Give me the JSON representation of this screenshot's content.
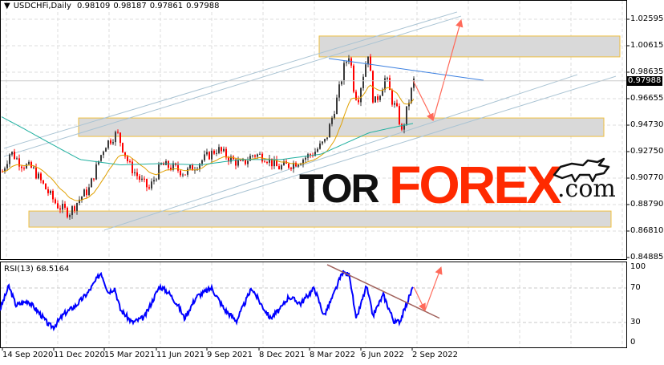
{
  "header": {
    "menu_icon": "triangle-down-icon",
    "symbol": "USDCHFi,Daily",
    "open": "0.98109",
    "high": "0.98187",
    "low": "0.97861",
    "close": "0.97988"
  },
  "rsi_header": {
    "label": "RSI(13)",
    "value": "68.5164"
  },
  "price_axis": {
    "labels": [
      "1.02595",
      "1.00615",
      "0.98635",
      "0.96655",
      "0.94730",
      "0.92750",
      "0.90770",
      "0.88790",
      "0.86810",
      "0.84885"
    ],
    "current": "0.97988"
  },
  "rsi_axis": {
    "labels": [
      "100",
      "70",
      "30",
      "0"
    ]
  },
  "time_axis": {
    "labels": [
      "14 Sep 2020",
      "11 Dec 2020",
      "15 Mar 2021",
      "11 Jun 2021",
      "9 Sep 2021",
      "8 Dec 2021",
      "8 Mar 2022",
      "6 Jun 2022",
      "2 Sep 2022"
    ]
  },
  "logo": {
    "part1": "TOR",
    "part2": "FOREX",
    "part3": ".com",
    "icon": "bull-icon"
  },
  "colors": {
    "bull": "#3a3a3a",
    "bear": "#ff0000",
    "ma_fast": "#e0a000",
    "ma_slow": "#20b0a0",
    "rsi": "#0000ff",
    "zone_fill": "#d9d9d9",
    "zone_border": "#f0c040",
    "arrow": "#ff6a5a",
    "channel": "#a9c3d3",
    "resistance": "#3a7fe0",
    "rsi_trend": "#a0605a"
  },
  "chart_data": {
    "type": "candlestick",
    "symbol": "USDCHFi",
    "timeframe": "Daily",
    "ylim": [
      0.84885,
      1.02595
    ],
    "price_path": [
      [
        2,
        0.912
      ],
      [
        12,
        0.927
      ],
      [
        25,
        0.918
      ],
      [
        40,
        0.914
      ],
      [
        55,
        0.9
      ],
      [
        70,
        0.887
      ],
      [
        85,
        0.881
      ],
      [
        100,
        0.893
      ],
      [
        110,
        0.899
      ],
      [
        122,
        0.92
      ],
      [
        130,
        0.932
      ],
      [
        145,
        0.941
      ],
      [
        160,
        0.917
      ],
      [
        175,
        0.905
      ],
      [
        185,
        0.899
      ],
      [
        200,
        0.917
      ],
      [
        215,
        0.915
      ],
      [
        230,
        0.911
      ],
      [
        250,
        0.92
      ],
      [
        270,
        0.929
      ],
      [
        285,
        0.922
      ],
      [
        300,
        0.917
      ],
      [
        315,
        0.925
      ],
      [
        330,
        0.923
      ],
      [
        345,
        0.915
      ],
      [
        360,
        0.917
      ],
      [
        375,
        0.921
      ],
      [
        390,
        0.926
      ],
      [
        405,
        0.935
      ],
      [
        412,
        0.95
      ],
      [
        420,
        0.968
      ],
      [
        428,
        0.99
      ],
      [
        435,
        1.001
      ],
      [
        440,
        0.975
      ],
      [
        445,
        0.965
      ],
      [
        452,
        0.985
      ],
      [
        458,
        1.001
      ],
      [
        465,
        0.962
      ],
      [
        472,
        0.97
      ],
      [
        480,
        0.983
      ],
      [
        488,
        0.965
      ],
      [
        495,
        0.956
      ],
      [
        500,
        0.941
      ],
      [
        507,
        0.96
      ],
      [
        515,
        0.98
      ]
    ],
    "ma_slow_path": [
      [
        2,
        0.953
      ],
      [
        30,
        0.944
      ],
      [
        60,
        0.934
      ],
      [
        100,
        0.921
      ],
      [
        150,
        0.917
      ],
      [
        200,
        0.918
      ],
      [
        250,
        0.917
      ],
      [
        300,
        0.921
      ],
      [
        350,
        0.921
      ],
      [
        400,
        0.925
      ],
      [
        430,
        0.933
      ],
      [
        460,
        0.941
      ],
      [
        490,
        0.945
      ],
      [
        515,
        0.948
      ]
    ],
    "rsi": {
      "period": 13,
      "levels": [
        70,
        30
      ],
      "path": [
        [
          0,
          45
        ],
        [
          11,
          72
        ],
        [
          20,
          50
        ],
        [
          35,
          55
        ],
        [
          50,
          40
        ],
        [
          61,
          27
        ],
        [
          67,
          25
        ],
        [
          80,
          40
        ],
        [
          95,
          50
        ],
        [
          110,
          65
        ],
        [
          126,
          88
        ],
        [
          135,
          65
        ],
        [
          143,
          70
        ],
        [
          150,
          45
        ],
        [
          165,
          30
        ],
        [
          180,
          36
        ],
        [
          199,
          72
        ],
        [
          210,
          65
        ],
        [
          222,
          50
        ],
        [
          230,
          35
        ],
        [
          245,
          60
        ],
        [
          264,
          70
        ],
        [
          280,
          45
        ],
        [
          295,
          32
        ],
        [
          314,
          70
        ],
        [
          325,
          52
        ],
        [
          337,
          35
        ],
        [
          350,
          46
        ],
        [
          360,
          60
        ],
        [
          375,
          52
        ],
        [
          392,
          70
        ],
        [
          404,
          38
        ],
        [
          415,
          60
        ],
        [
          427,
          88
        ],
        [
          436,
          85
        ],
        [
          444,
          33
        ],
        [
          457,
          72
        ],
        [
          465,
          38
        ],
        [
          478,
          62
        ],
        [
          492,
          30
        ],
        [
          499,
          32
        ],
        [
          515,
          71
        ]
      ]
    },
    "zones": [
      [
        398,
        773,
        1.0134,
        0.9978
      ],
      [
        98,
        753,
        0.9521,
        0.9383
      ],
      [
        36,
        762,
        0.8825,
        0.8705
      ]
    ],
    "channel_lines": [
      [
        5,
        0.9294,
        570,
        1.0314
      ],
      [
        5,
        0.9233,
        575,
        1.0283
      ],
      [
        130,
        0.8682,
        720,
        0.9845
      ],
      [
        210,
        0.8795,
        768,
        0.9833
      ]
    ],
    "resistance_line": [
      410,
      0.9966,
      603,
      0.9803
    ],
    "forecast_arrows": [
      [
        515,
        0.9803,
        540,
        0.9503
      ],
      [
        540,
        0.9503,
        575,
        1.0253
      ]
    ],
    "rsi_trend_line": [
      408,
      97,
      548,
      35
    ],
    "rsi_arrows": [
      [
        516,
        71,
        530,
        44
      ],
      [
        530,
        44,
        550,
        94
      ]
    ]
  }
}
